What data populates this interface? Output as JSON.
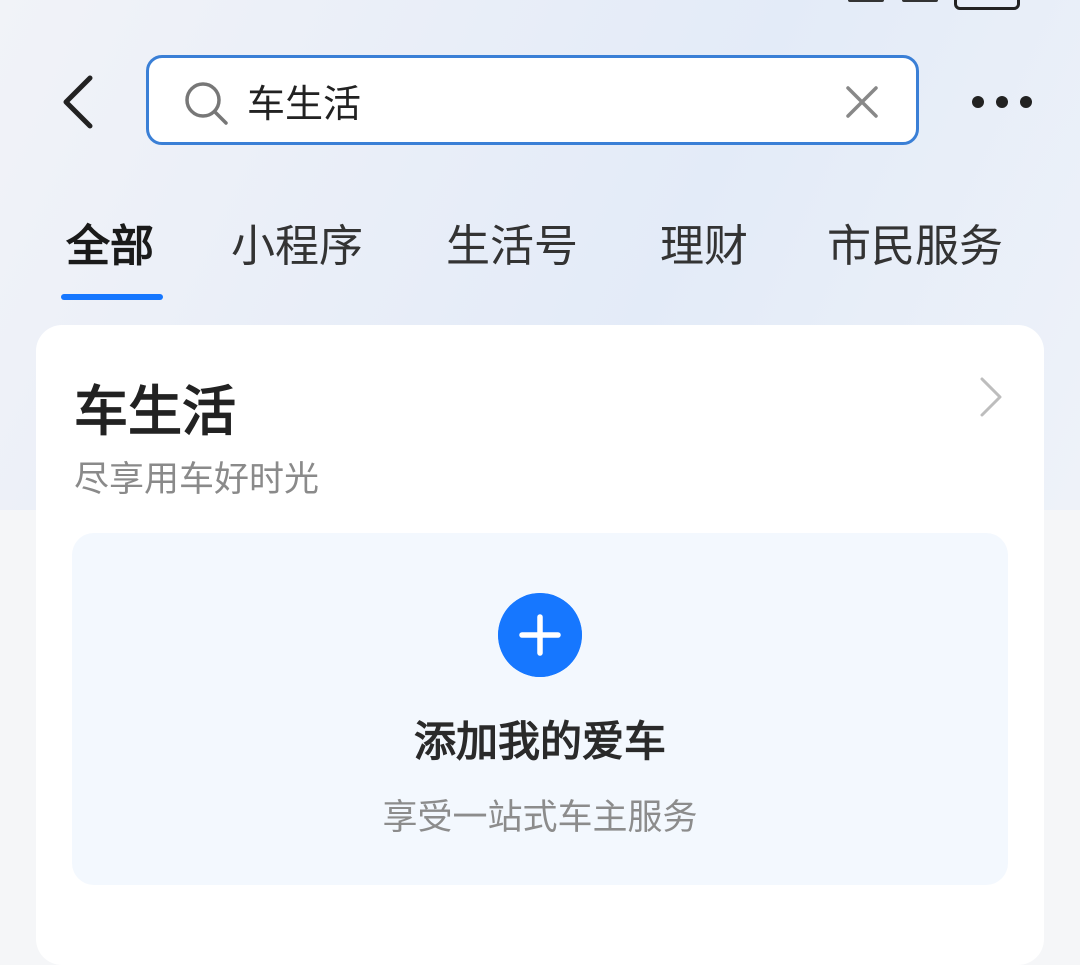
{
  "search": {
    "value": "车生活"
  },
  "tabs": [
    {
      "label": "全部",
      "active": true
    },
    {
      "label": "小程序",
      "active": false
    },
    {
      "label": "生活号",
      "active": false
    },
    {
      "label": "理财",
      "active": false
    },
    {
      "label": "市民服务",
      "active": false
    }
  ],
  "card": {
    "title": "车生活",
    "subtitle": "尽享用车好时光",
    "add_car": {
      "title": "添加我的爱车",
      "subtitle": "享受一站式车主服务"
    }
  },
  "colors": {
    "accent": "#1677ff",
    "search_border": "#3a7fd6"
  },
  "icons": {
    "back": "chevron-left-icon",
    "search": "search-icon",
    "clear": "close-icon",
    "more": "more-dots-icon",
    "card_arrow": "chevron-right-icon",
    "add": "plus-circle-icon"
  }
}
